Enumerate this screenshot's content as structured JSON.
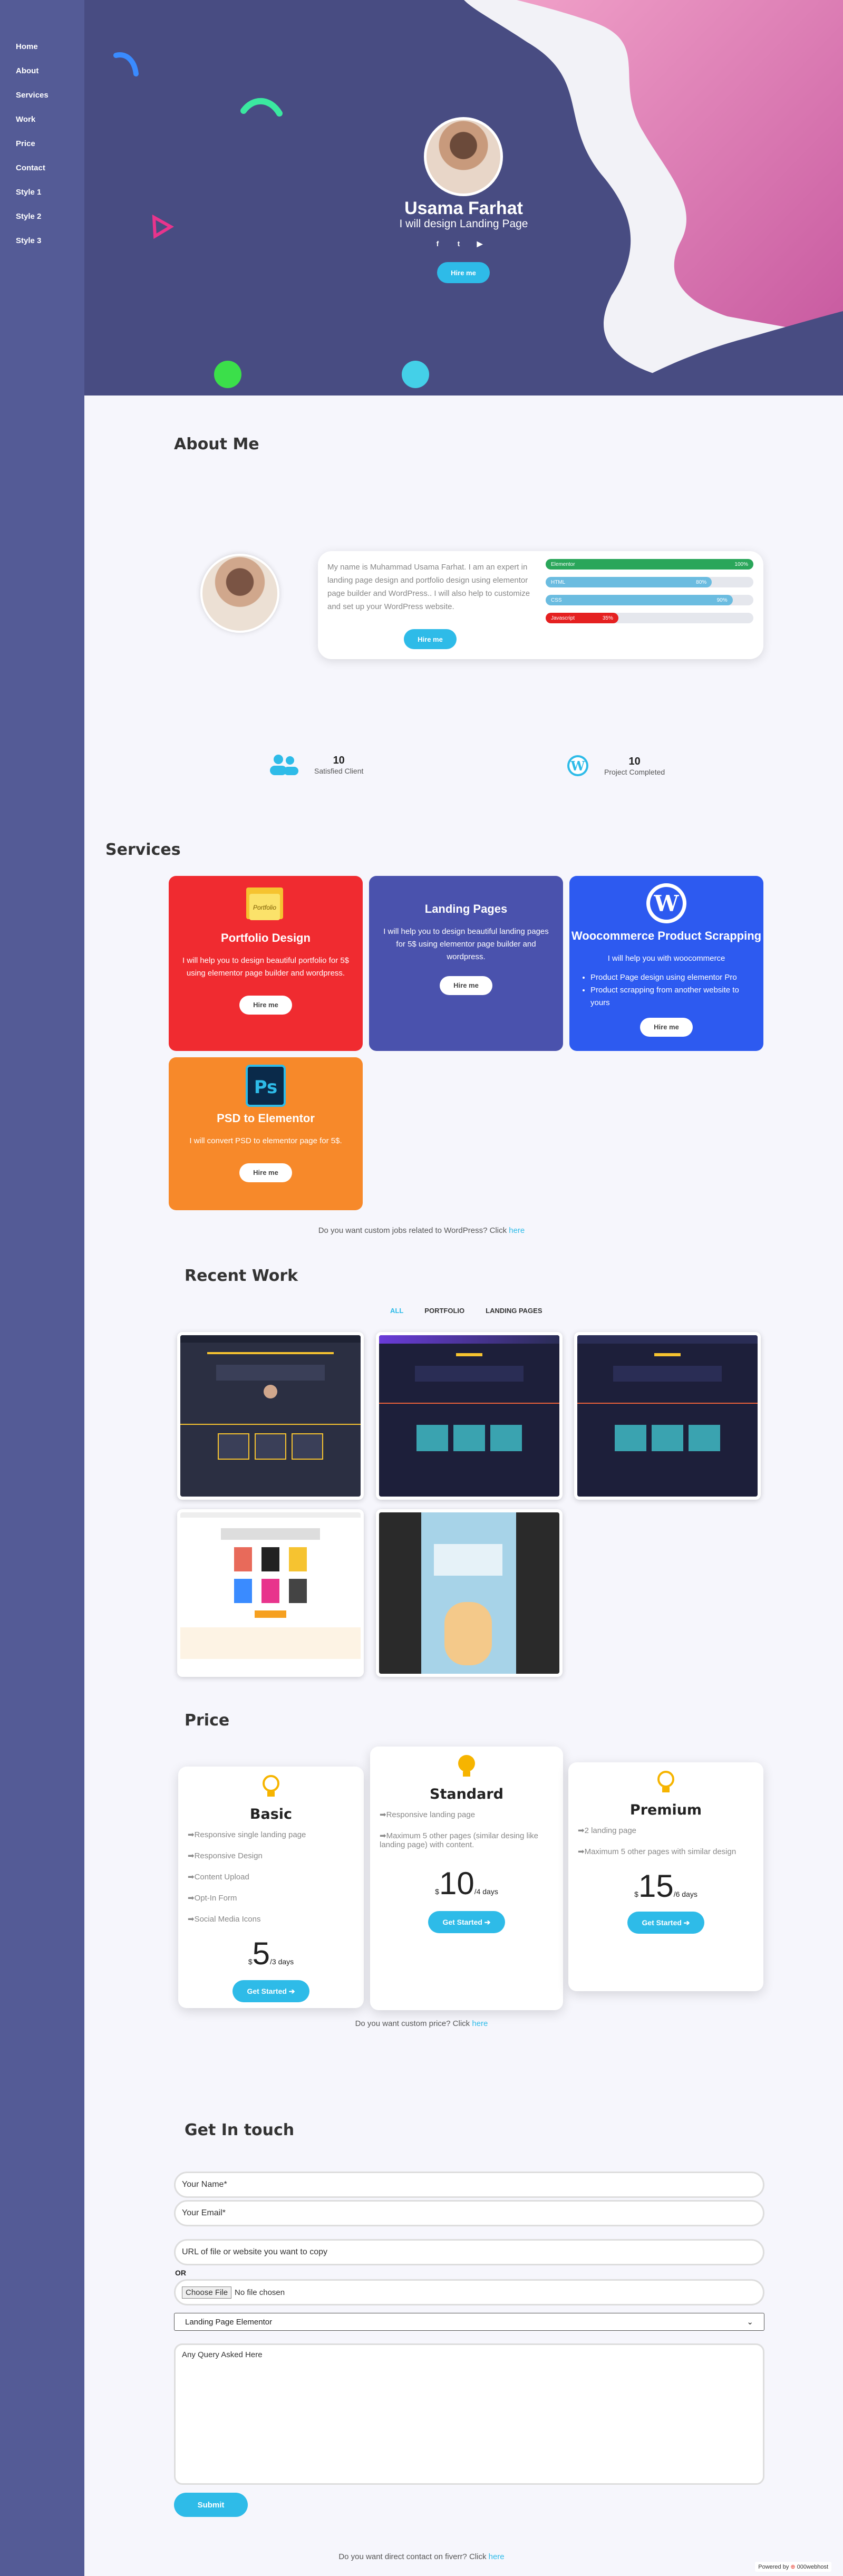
{
  "nav": [
    "Home",
    "About",
    "Services",
    "Work",
    "Price",
    "Contact",
    "Style 1",
    "Style 2",
    "Style 3"
  ],
  "hero": {
    "name": "Usama Farhat",
    "subtitle": "I will design Landing Page",
    "hire_label": "Hire me",
    "social_icons": [
      "facebook-icon",
      "twitter-icon",
      "youtube-icon"
    ],
    "colors": {
      "bg": "#484c82",
      "pink": "#e178b0",
      "accent": "#2ebbe8"
    }
  },
  "about": {
    "title": "About Me",
    "text": "My name is Muhammad Usama Farhat. I am an expert in landing page design and portfolio design using elementor page builder and WordPress.. I will also help to customize and set up your WordPress website.",
    "hire_label": "Hire me",
    "skills": [
      {
        "name": "Elementor",
        "percent": "100%",
        "value": 1.0,
        "color": "#2aa65a"
      },
      {
        "name": "HTML",
        "percent": "80%",
        "value": 0.8,
        "color": "#6bbce0"
      },
      {
        "name": "CSS",
        "percent": "90%",
        "value": 0.9,
        "color": "#6bbce0"
      },
      {
        "name": "Javascript",
        "percent": "35%",
        "value": 0.35,
        "color": "#e52020"
      }
    ],
    "stats": [
      {
        "number": "10",
        "label": "Satisfied Client",
        "icon": "users-icon"
      },
      {
        "number": "10",
        "label": "Project Completed",
        "icon": "wordpress-icon"
      }
    ]
  },
  "services": {
    "title": "Services",
    "items": [
      {
        "title": "Portfolio Design",
        "text": "I will help you to design beautiful portfolio for 5$ using elementor page builder and wordpress.",
        "button": "Hire me",
        "color": "#f02b30",
        "icon": "portfolio-folder-icon"
      },
      {
        "title": "Landing Pages",
        "text": "I will help you to design beautiful landing pages for 5$ using elementor page builder and wordpress.",
        "button": "Hire me",
        "color": "#4a52ad"
      },
      {
        "title": "Woocommerce Product Scrapping",
        "text": "I will help you with woocommerce",
        "bullets": [
          "Product Page design using elementor Pro",
          "Product scrapping from another website to yours"
        ],
        "button": "Hire me",
        "color": "#2d5af0",
        "icon": "wordpress-icon"
      },
      {
        "title": "PSD to Elementor",
        "text": "I will convert PSD to elementor page for 5$.",
        "button": "Hire me",
        "color": "#f7892a",
        "icon": "photoshop-icon"
      }
    ],
    "note_text": "Do you want custom jobs related to WordPress? Click",
    "note_link": "here"
  },
  "work": {
    "title": "Recent Work",
    "filters": [
      "ALL",
      "PORTFOLIO",
      "LANDING PAGES"
    ]
  },
  "price": {
    "title": "Price",
    "plans": [
      {
        "name": "Basic",
        "features": [
          "Responsive single landing page",
          "Responsive Design",
          "Content Upload",
          "Opt-In Form",
          "Social Media Icons"
        ],
        "currency": "$",
        "amount": "5",
        "period": "/3 days",
        "button": "Get Started"
      },
      {
        "name": "Standard",
        "features": [
          "Responsive landing page",
          "Maximum 5 other pages (similar desing like landing page) with content."
        ],
        "currency": "$",
        "amount": "10",
        "period": "/4 days",
        "button": "Get Started"
      },
      {
        "name": "Premium",
        "features": [
          "2 landing page",
          "Maximum 5 other pages with similar design"
        ],
        "currency": "$",
        "amount": "15",
        "period": "/6 days",
        "button": "Get Started"
      }
    ],
    "note_text": "Do you want custom price? Click",
    "note_link": "here"
  },
  "contact": {
    "title": "Get In touch",
    "name_placeholder": "Your Name*",
    "email_placeholder": "Your Email*",
    "url_placeholder": "URL of file or website you want to copy",
    "or_label": "OR",
    "file_button": "Choose File",
    "file_status": "No file chosen",
    "select_value": "Landing Page Elementor",
    "query_placeholder": "Any Query Asked Here",
    "submit": "Submit",
    "note_text": "Do you want direct contact on fiverr? Click",
    "note_link": "here"
  },
  "footer": {
    "powered": "Powered by",
    "brand": "000webhost"
  }
}
